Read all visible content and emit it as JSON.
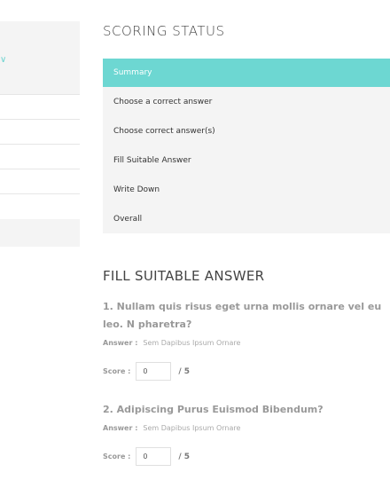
{
  "sidebar": {
    "chevron": "∨",
    "items": [
      "",
      "",
      "",
      "",
      ""
    ]
  },
  "scoring_status": {
    "title": "SCORING STATUS",
    "rows": [
      "Summary",
      "Choose a correct answer",
      "Choose correct answer(s)",
      "Fill Suitable Answer",
      "Write Down",
      "Overall"
    ]
  },
  "section": {
    "title": "FILL SUITABLE ANSWER"
  },
  "questions": [
    {
      "text": "1. Nullam quis risus eget urna mollis ornare vel eu leo. N pharetra?",
      "answer_label": "Answer :",
      "answer_value": "Sem Dapibus Ipsum Ornare",
      "score_label": "Score :",
      "score_value": "0",
      "score_max": "/ 5"
    },
    {
      "text": "2. Adipiscing Purus Euismod Bibendum?",
      "answer_label": "Answer :",
      "answer_value": "Sem Dapibus Ipsum Ornare",
      "score_label": "Score :",
      "score_value": "0",
      "score_max": "/ 5"
    }
  ],
  "colors": {
    "accent": "#6dd7d2"
  }
}
